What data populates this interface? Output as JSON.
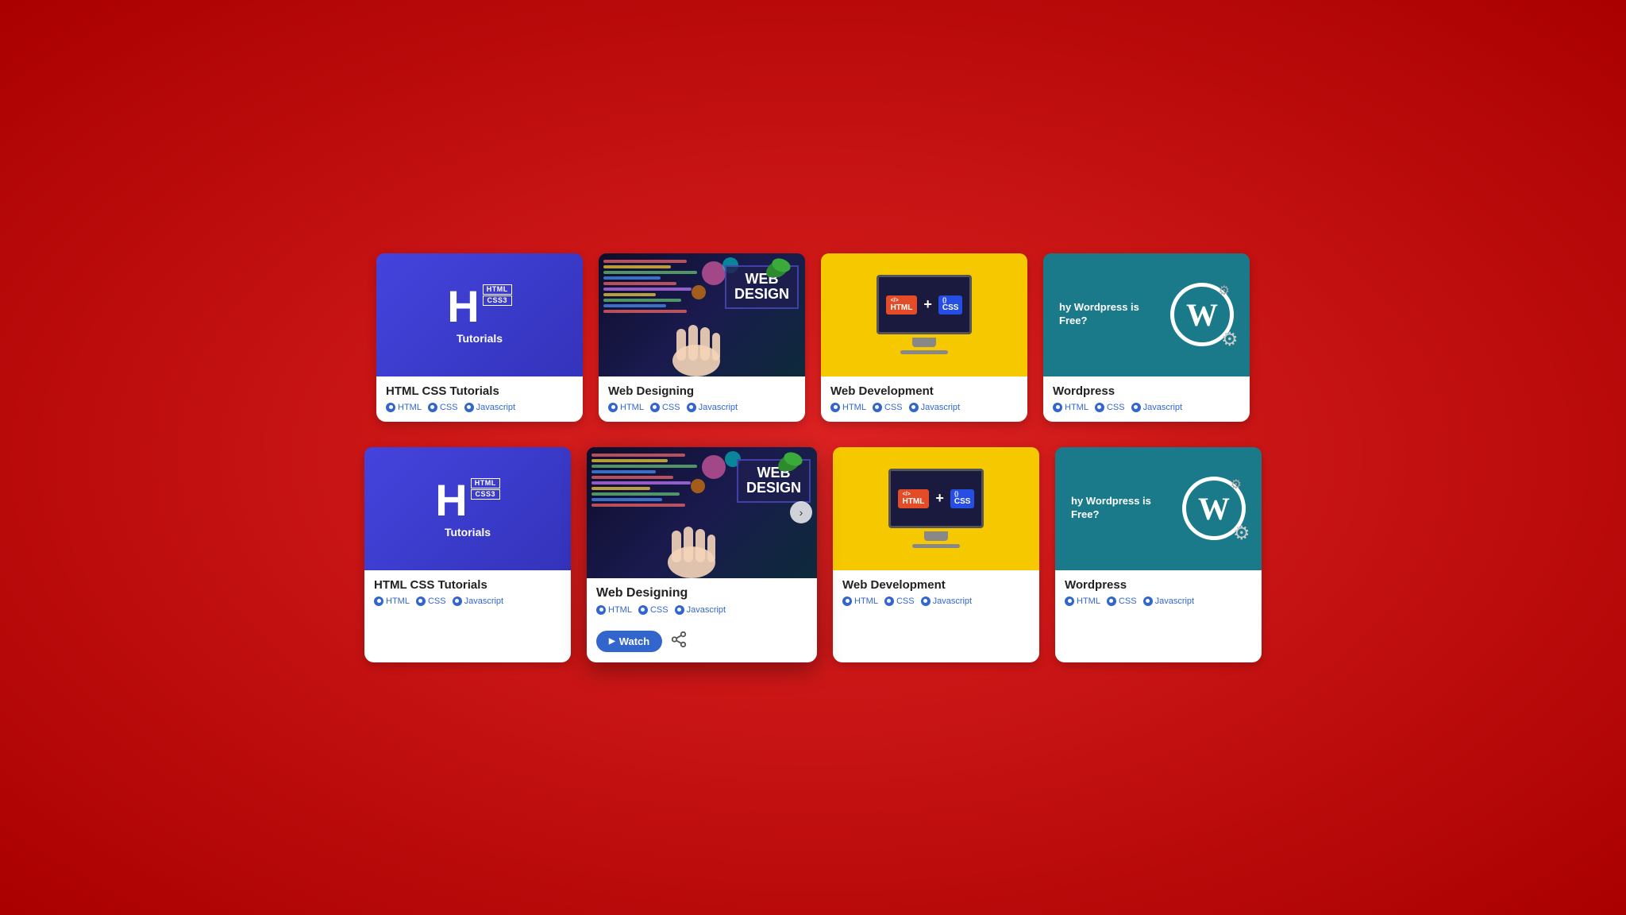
{
  "bg_color": "#cc0000",
  "rows": [
    {
      "id": "row1",
      "cards": [
        {
          "id": "card-html-css-1",
          "type": "html-css",
          "title": "HTML CSS Tutorials",
          "tags": [
            "HTML",
            "CSS",
            "Javascript"
          ],
          "expanded": false
        },
        {
          "id": "card-web-designing-1",
          "type": "web-designing",
          "title": "Web Designing",
          "tags": [
            "HTML",
            "CSS",
            "Javascript"
          ],
          "expanded": false
        },
        {
          "id": "card-web-dev-1",
          "type": "web-dev",
          "title": "Web Development",
          "tags": [
            "HTML",
            "CSS",
            "Javascript"
          ],
          "expanded": false
        },
        {
          "id": "card-wordpress-1",
          "type": "wordpress",
          "title": "Wordpress",
          "tags": [
            "HTML",
            "CSS",
            "Javascript"
          ],
          "expanded": false,
          "wp_question": "hy Wordpress is Free?"
        }
      ]
    },
    {
      "id": "row2",
      "cards": [
        {
          "id": "card-html-css-2",
          "type": "html-css",
          "title": "HTML CSS Tutorials",
          "tags": [
            "HTML",
            "CSS",
            "Javascript"
          ],
          "expanded": false
        },
        {
          "id": "card-web-designing-2",
          "type": "web-designing",
          "title": "Web Designing",
          "tags": [
            "HTML",
            "CSS",
            "Javascript"
          ],
          "expanded": true,
          "watch_label": "Watch",
          "share_icon": "⬡"
        },
        {
          "id": "card-web-dev-2",
          "type": "web-dev",
          "title": "Web Development",
          "tags": [
            "HTML",
            "CSS",
            "Javascript"
          ],
          "expanded": false
        },
        {
          "id": "card-wordpress-2",
          "type": "wordpress",
          "title": "Wordpress",
          "tags": [
            "HTML",
            "CSS",
            "Javascript"
          ],
          "expanded": false,
          "wp_question": "hy Wordpress is Free?"
        }
      ]
    }
  ],
  "tag_labels": {
    "html": "HTML",
    "css": "CSS",
    "js": "Javascript"
  },
  "logo": {
    "h_letter": "H",
    "html_text": "HTML",
    "css3_text": "CSS3",
    "tutorials": "Tutorials"
  },
  "web_design_label_line1": "WEB",
  "web_design_label_line2": "DESIGN",
  "monitor_html": "HTML",
  "monitor_plus": "+",
  "monitor_css": "CSS",
  "wp_w": "W",
  "watch_button_label": "Watch"
}
